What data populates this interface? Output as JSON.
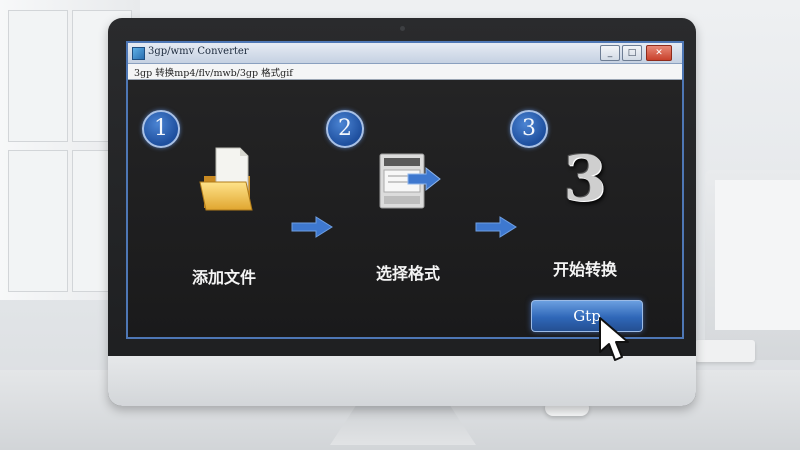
{
  "window": {
    "title": "3gp/wmv Converter",
    "address": "3gp 转换mp4/flv/mwb/3gp 格式gif",
    "controls": {
      "minimize": "_",
      "maximize": "□",
      "close": "✕"
    }
  },
  "steps": [
    {
      "number": "1",
      "label": "添加文件",
      "icon": "folder-document-icon"
    },
    {
      "number": "2",
      "label": "选择格式",
      "icon": "printer-format-icon"
    },
    {
      "number": "3",
      "label": "开始转换",
      "icon": "big-number-3-icon",
      "glyph": "3"
    }
  ],
  "convert_button": {
    "label": "Gtp"
  },
  "colors": {
    "accent": "#2f67b8",
    "badge_border": "#a9c1e6",
    "arrow": "#3e78cf",
    "screen": "#1b1b1c"
  }
}
